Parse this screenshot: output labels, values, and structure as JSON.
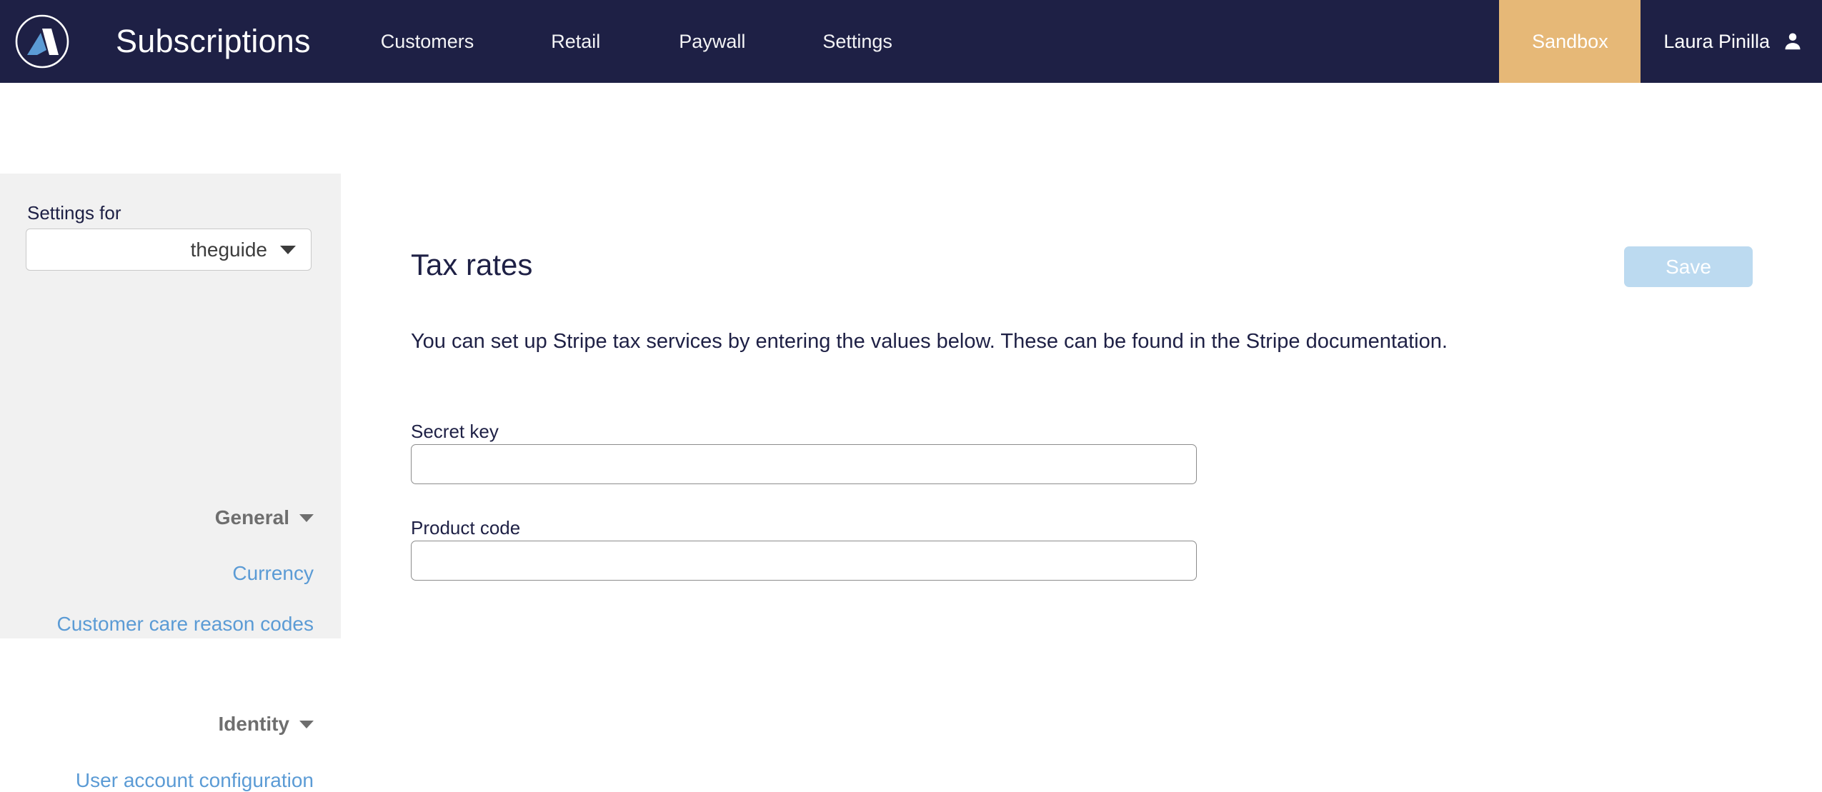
{
  "header": {
    "logo_icon": "aptitude-a-logo-icon",
    "app_title": "Subscriptions",
    "nav": [
      {
        "label": "Customers"
      },
      {
        "label": "Retail"
      },
      {
        "label": "Paywall"
      },
      {
        "label": "Settings"
      }
    ],
    "env_badge": "Sandbox",
    "env_badge_color": "#e6b877",
    "user_name": "Laura Pinilla",
    "user_icon": "user-avatar-icon"
  },
  "sidebar": {
    "settings_for_label": "Settings for",
    "org_select_value": "theguide",
    "groups": [
      {
        "label": "General",
        "caret_icon": "chevron-down-icon",
        "links": [
          {
            "label": "Currency"
          },
          {
            "label": "Customer care reason codes"
          }
        ]
      },
      {
        "label": "Identity",
        "caret_icon": "chevron-down-icon",
        "links": [
          {
            "label": "User account configuration"
          }
        ]
      }
    ],
    "link_color": "#5b9bd5",
    "background": "#f1f1f1"
  },
  "main": {
    "page_title": "Tax rates",
    "save_label": "Save",
    "save_color": "#bcdaf0",
    "description": "You can set up Stripe tax services by entering the values below. These can be found in the Stripe documentation.",
    "fields": [
      {
        "label": "Secret key",
        "value": "",
        "placeholder": ""
      },
      {
        "label": "Product code",
        "value": "",
        "placeholder": ""
      }
    ]
  }
}
